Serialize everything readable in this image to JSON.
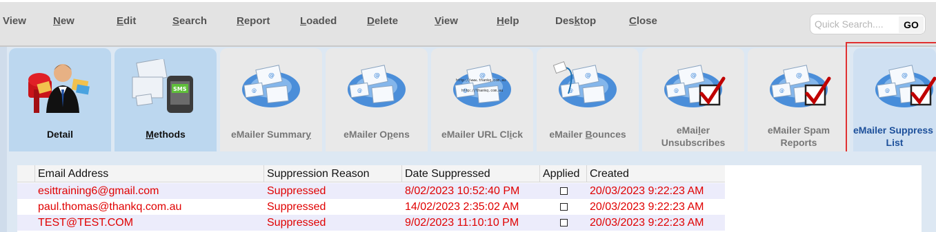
{
  "menu": {
    "items": [
      {
        "pre": "",
        "acc": "",
        "post": "View"
      },
      {
        "pre": "",
        "acc": "N",
        "post": "ew"
      },
      {
        "pre": "",
        "acc": "E",
        "post": "dit"
      },
      {
        "pre": "",
        "acc": "S",
        "post": "earch"
      },
      {
        "pre": "",
        "acc": "R",
        "post": "eport"
      },
      {
        "pre": "",
        "acc": "L",
        "post": "oaded"
      },
      {
        "pre": "",
        "acc": "D",
        "post": "elete"
      },
      {
        "pre": "",
        "acc": "V",
        "post": "iew"
      },
      {
        "pre": "",
        "acc": "H",
        "post": "elp"
      },
      {
        "pre": "Des",
        "acc": "k",
        "post": "top"
      },
      {
        "pre": "",
        "acc": "C",
        "post": "lose"
      }
    ],
    "quick_search_placeholder": "Quick Search....",
    "go_label": "GO"
  },
  "tabs": [
    {
      "line1_pre": "Detail",
      "line1_acc": "",
      "line1_post": "",
      "line2": "",
      "icon": "contact-person-mailbox-icon"
    },
    {
      "line1_pre": "",
      "line1_acc": "M",
      "line1_post": "ethods",
      "line2": "",
      "icon": "sms-envelopes-icon"
    },
    {
      "line1_pre": "eMailer Summar",
      "line1_acc": "y",
      "line1_post": "",
      "line2": "",
      "icon": "emailer-envelopes-icon"
    },
    {
      "line1_pre": "eMailer O",
      "line1_acc": "p",
      "line1_post": "ens",
      "line2": "",
      "icon": "emailer-envelopes-icon"
    },
    {
      "line1_pre": "eMailer URL Cl",
      "line1_acc": "i",
      "line1_post": "ck",
      "line2": "",
      "icon": "emailer-url-icon"
    },
    {
      "line1_pre": "eMailer ",
      "line1_acc": "B",
      "line1_post": "ounces",
      "line2": "",
      "icon": "emailer-bounce-icon"
    },
    {
      "line1_pre": "eMai",
      "line1_acc": "l",
      "line1_post": "er",
      "line2": "Unsubscribes",
      "icon": "emailer-checkmark-icon"
    },
    {
      "line1_pre": "eMailer Spam",
      "line1_acc": "",
      "line1_post": "",
      "line2": "Reports",
      "icon": "emailer-checkmark-icon"
    },
    {
      "line1_pre": "eMailer Suppress",
      "line1_acc": "",
      "line1_post": "",
      "line2": "List",
      "icon": "emailer-checkmark-icon"
    }
  ],
  "grid": {
    "columns": [
      "Email Address",
      "Suppression Reason",
      "Date Suppressed",
      "Applied",
      "Created"
    ],
    "rows": [
      {
        "email": "esittraining6@gmail.com",
        "reason": "Suppressed",
        "date": "8/02/2023 10:52:40 PM",
        "applied": false,
        "created": "20/03/2023 9:22:23 AM"
      },
      {
        "email": "paul.thomas@thankq.com.au",
        "reason": "Suppressed",
        "date": "14/02/2023 2:35:02 AM",
        "applied": false,
        "created": "20/03/2023 9:22:23 AM"
      },
      {
        "email": "TEST@TEST.COM",
        "reason": "Suppressed",
        "date": "9/02/2023 11:10:10 PM",
        "applied": false,
        "created": "20/03/2023 9:22:23 AM"
      }
    ]
  },
  "colors": {
    "row_text": "#e00000",
    "active_tab_text": "#1c4f9a",
    "active_outline": "#e03030",
    "checkmark": "#c00000"
  }
}
